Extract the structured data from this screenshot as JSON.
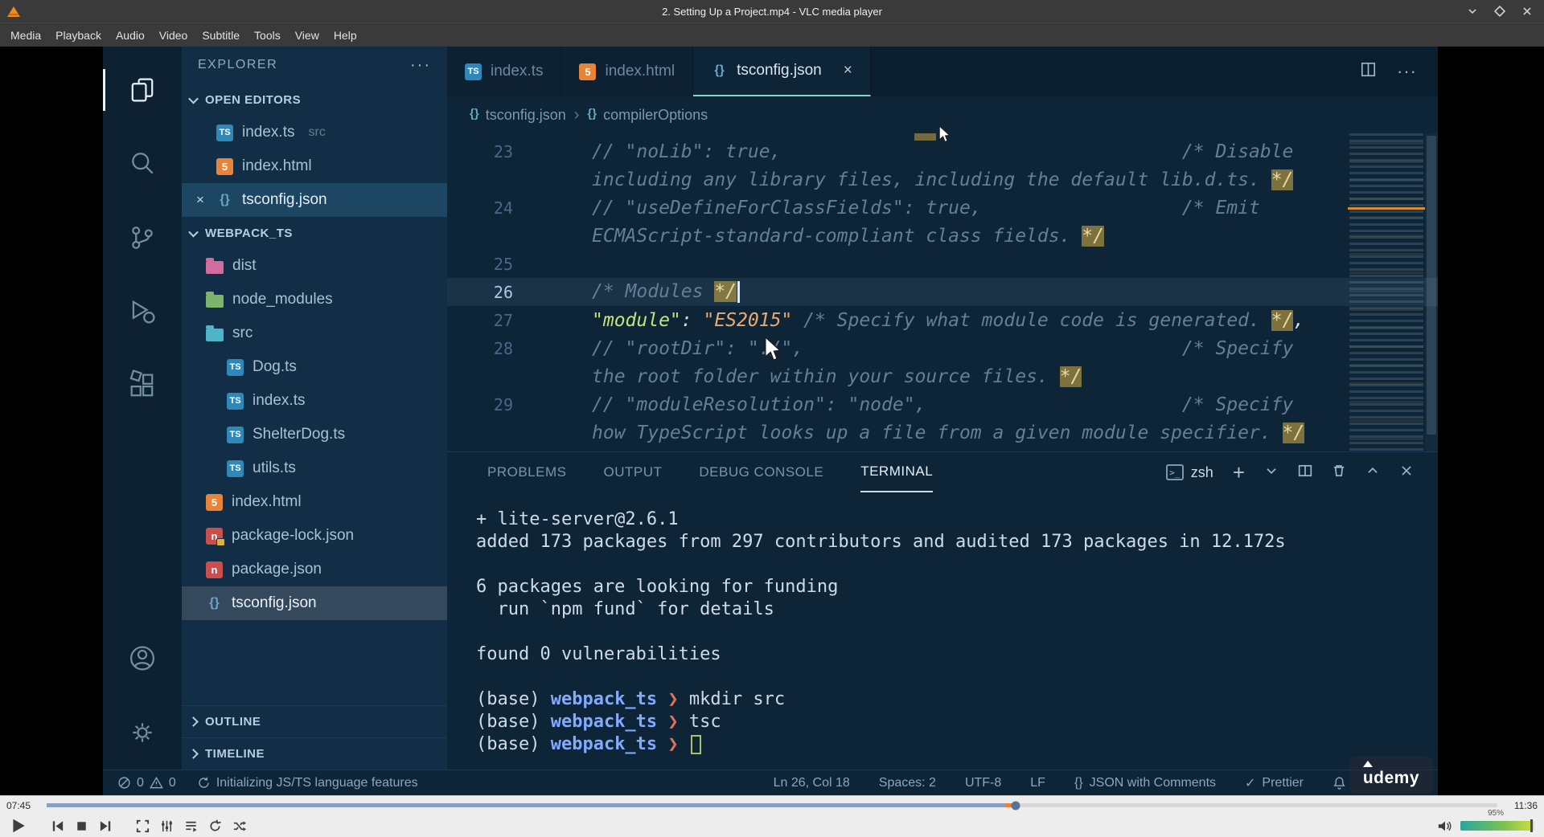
{
  "vlc": {
    "title": "2. Setting Up a Project.mp4 - VLC media player",
    "menu": [
      "Media",
      "Playback",
      "Audio",
      "Video",
      "Subtitle",
      "Tools",
      "View",
      "Help"
    ],
    "time_elapsed": "07:45",
    "time_total": "11:36",
    "progress_pct": 66.8,
    "volume_pct": 95,
    "volume_label": "95%"
  },
  "vscode": {
    "activity_bar": [
      {
        "name": "explorer",
        "active": true
      },
      {
        "name": "search"
      },
      {
        "name": "source-control"
      },
      {
        "name": "run-debug"
      },
      {
        "name": "extensions"
      },
      {
        "name": "accounts",
        "bottom": true
      },
      {
        "name": "settings"
      }
    ],
    "explorer": {
      "title": "EXPLORER",
      "open_editors_label": "OPEN EDITORS",
      "open_editors": [
        {
          "name": "index.ts",
          "icon": "ts",
          "badge": "src"
        },
        {
          "name": "index.html",
          "icon": "html"
        },
        {
          "name": "tsconfig.json",
          "icon": "json",
          "active": true
        }
      ],
      "workspace_label": "WEBPACK_TS",
      "tree": [
        {
          "name": "dist",
          "icon": "folder-dist",
          "indent": 0
        },
        {
          "name": "node_modules",
          "icon": "folder-node",
          "indent": 0
        },
        {
          "name": "src",
          "icon": "folder-src",
          "indent": 0
        },
        {
          "name": "Dog.ts",
          "icon": "ts",
          "indent": 1
        },
        {
          "name": "index.ts",
          "icon": "ts",
          "indent": 1
        },
        {
          "name": "ShelterDog.ts",
          "icon": "ts",
          "indent": 1
        },
        {
          "name": "utils.ts",
          "icon": "ts",
          "indent": 1
        },
        {
          "name": "index.html",
          "icon": "html",
          "indent": 0
        },
        {
          "name": "package-lock.json",
          "icon": "npm-lock",
          "indent": 0
        },
        {
          "name": "package.json",
          "icon": "npm",
          "indent": 0
        },
        {
          "name": "tsconfig.json",
          "icon": "json",
          "indent": 0,
          "selected": true
        }
      ],
      "bottom_sections": [
        "OUTLINE",
        "TIMELINE"
      ]
    },
    "tabs": [
      {
        "name": "index.ts",
        "icon": "ts"
      },
      {
        "name": "index.html",
        "icon": "html"
      },
      {
        "name": "tsconfig.json",
        "icon": "json",
        "active": true
      }
    ],
    "breadcrumb": [
      "tsconfig.json",
      "compilerOptions"
    ],
    "editor": {
      "rows": [
        {
          "num": "23",
          "segs": [
            [
              "c",
              "// \"noLib\": true,                                    /* Disable"
            ]
          ]
        },
        {
          "num": "",
          "segs": [
            [
              "c",
              "including any library files, including the default lib.d.ts. "
            ],
            [
              "m",
              "*/"
            ]
          ]
        },
        {
          "num": "24",
          "segs": [
            [
              "c",
              "// \"useDefineForClassFields\": true,                  /* Emit"
            ]
          ]
        },
        {
          "num": "",
          "segs": [
            [
              "c",
              "ECMAScript-standard-compliant class fields. "
            ],
            [
              "m",
              "*/"
            ]
          ]
        },
        {
          "num": "25",
          "segs": []
        },
        {
          "num": "26",
          "current": true,
          "segs": [
            [
              "c",
              "/* Modules "
            ],
            [
              "m",
              "*/"
            ],
            [
              "cur",
              ""
            ]
          ]
        },
        {
          "num": "27",
          "segs": [
            [
              "k",
              "\"module\""
            ],
            [
              "p",
              ": "
            ],
            [
              "s",
              "\"ES2015\""
            ],
            [
              "t",
              " "
            ],
            [
              "c",
              "/* Specify what module code is generated. "
            ],
            [
              "m",
              "*/"
            ],
            [
              "p",
              ","
            ]
          ]
        },
        {
          "num": "28",
          "segs": [
            [
              "c",
              "// \"rootDir\": \"./\",                                  /* Specify"
            ]
          ]
        },
        {
          "num": "",
          "segs": [
            [
              "c",
              "the root folder within your source files. "
            ],
            [
              "m",
              "*/"
            ]
          ]
        },
        {
          "num": "29",
          "segs": [
            [
              "c",
              "// \"moduleResolution\": \"node\",                       /* Specify"
            ]
          ]
        },
        {
          "num": "",
          "segs": [
            [
              "c",
              "how TypeScript looks up a file from a given module specifier. "
            ],
            [
              "m",
              "*/"
            ]
          ]
        }
      ]
    },
    "panel": {
      "tabs": [
        "PROBLEMS",
        "OUTPUT",
        "DEBUG CONSOLE",
        "TERMINAL"
      ],
      "active_tab": "TERMINAL",
      "shell_label": "zsh",
      "terminal_rows": [
        [
          [
            "t",
            "+ lite-server@2.6.1"
          ]
        ],
        [
          [
            "t",
            "added 173 packages from 297 contributors and audited 173 packages in 12.172s"
          ]
        ],
        [],
        [
          [
            "t",
            "6 packages are looking for funding"
          ]
        ],
        [
          [
            "t",
            "  run `npm fund` for details"
          ]
        ],
        [],
        [
          [
            "t",
            "found 0 vulnerabilities"
          ]
        ],
        [],
        [
          [
            "t",
            "(base) "
          ],
          [
            "dir",
            "webpack_ts"
          ],
          [
            "sym",
            " ❯ "
          ],
          [
            "t",
            "mkdir src"
          ]
        ],
        [
          [
            "t",
            "(base) "
          ],
          [
            "dir",
            "webpack_ts"
          ],
          [
            "sym",
            " ❯ "
          ],
          [
            "t",
            "tsc"
          ]
        ],
        [
          [
            "t",
            "(base) "
          ],
          [
            "dir",
            "webpack_ts"
          ],
          [
            "sym",
            " ❯ "
          ],
          [
            "block",
            ""
          ]
        ]
      ]
    },
    "status": {
      "errors": "0",
      "warnings": "0",
      "message": "Initializing JS/TS language features",
      "cursor": "Ln 26, Col 18",
      "indent": "Spaces: 2",
      "encoding": "UTF-8",
      "eol": "LF",
      "language_icon": "{}",
      "language": "JSON with Comments",
      "formatter_check": "✓",
      "formatter": "Prettier",
      "watermark": "udemy"
    }
  }
}
